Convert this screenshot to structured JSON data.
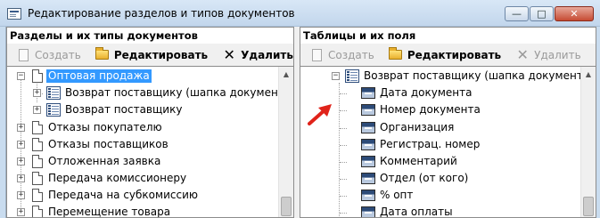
{
  "window": {
    "title": "Редактирование разделов и типов документов",
    "controls": {
      "minimize": "—",
      "maximize": "□",
      "close": "✕"
    }
  },
  "left_panel": {
    "header": "Разделы и их типы документов",
    "toolbar": {
      "create": "Создать",
      "edit": "Редактировать",
      "delete": "Удалить"
    },
    "tree": {
      "selected": "Оптовая продажа",
      "children": [
        "Возврат поставщику (шапка документа)",
        "Возврат поставщику"
      ],
      "siblings": [
        "Отказы покупателю",
        "Отказы поставщиков",
        "Отложенная заявка",
        "Передача комиссионеру",
        "Передача на субкомиссию",
        "Перемещение товара"
      ]
    }
  },
  "right_panel": {
    "header": "Таблицы и их поля",
    "toolbar": {
      "create": "Создать",
      "edit": "Редактировать",
      "delete": "Удалить"
    },
    "tree": {
      "root": "Возврат поставщику (шапка документа)",
      "fields": [
        "Дата документа",
        "Номер документа",
        "Организация",
        "Регистрац. номер",
        "Комментарий",
        "Отдел (от кого)",
        "% опт",
        "Дата оплаты"
      ]
    }
  },
  "move_button": "<<",
  "icons": [
    "app-icon",
    "new-doc-icon",
    "folder-icon",
    "close-x-icon",
    "doc-icon",
    "table-icon",
    "field-icon",
    "red-arrow-icon"
  ],
  "colors": {
    "selection": "#3399ff",
    "arrow": "#e0231a",
    "titlebar": "#c9dcef"
  }
}
